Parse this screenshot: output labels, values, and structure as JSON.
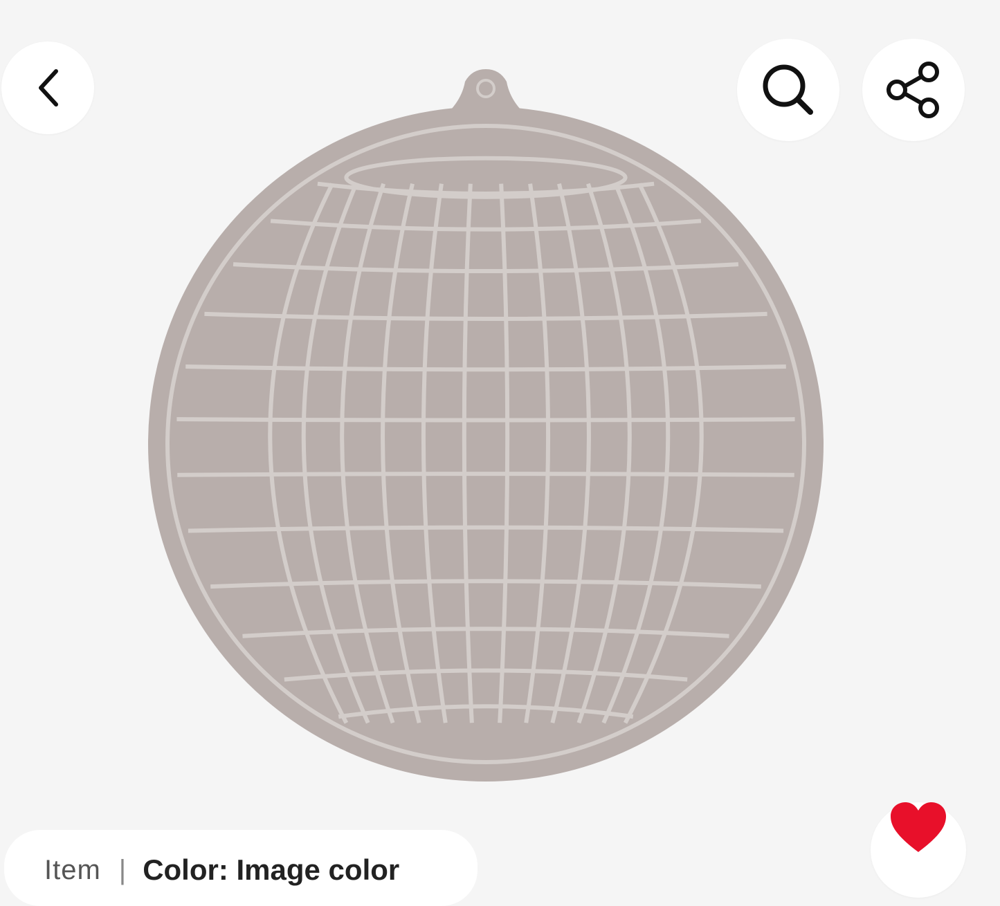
{
  "colors": {
    "background": "#f5f5f5",
    "product": "#b8aeab",
    "product_line": "#d3cdca",
    "button_bg": "#ffffff",
    "icon": "#111111",
    "favorite": "#e8102a"
  },
  "icons": {
    "back": "chevron-left-icon",
    "search": "search-icon",
    "share": "share-icon",
    "favorite": "heart-icon"
  },
  "variant": {
    "item_label": "Item",
    "separator": "|",
    "color_label": "Color: Image color"
  }
}
